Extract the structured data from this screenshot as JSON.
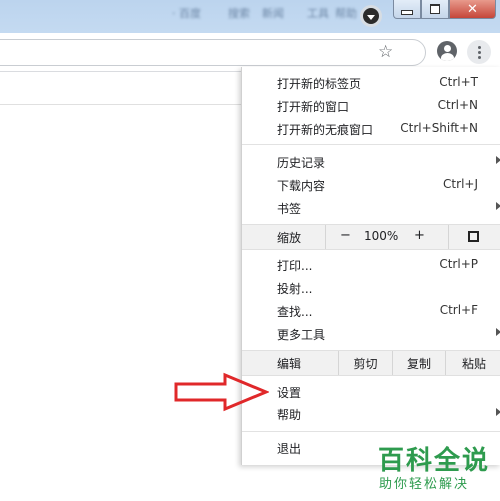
{
  "titlebar": {
    "blurred_tabs": [
      "· 百度",
      "搜索",
      "新闻",
      "工具",
      "帮助"
    ]
  },
  "window_controls": {
    "minimize_icon": "minimize-icon",
    "maximize_icon": "restore-icon",
    "close_glyph": "✕"
  },
  "toolbar": {
    "bookmark_star": "☆"
  },
  "menu": {
    "group1": [
      {
        "label": "打开新的标签页",
        "shortcut": "Ctrl+T"
      },
      {
        "label": "打开新的窗口",
        "shortcut": "Ctrl+N"
      },
      {
        "label": "打开新的无痕窗口",
        "shortcut": "Ctrl+Shift+N"
      }
    ],
    "group2": [
      {
        "label": "历史记录",
        "shortcut": ""
      },
      {
        "label": "下载内容",
        "shortcut": "Ctrl+J"
      },
      {
        "label": "书签",
        "shortcut": ""
      }
    ],
    "zoom": {
      "label": "缩放",
      "minus": "−",
      "value": "100%",
      "plus": "+"
    },
    "group3": [
      {
        "label": "打印...",
        "shortcut": "Ctrl+P"
      },
      {
        "label": "投射...",
        "shortcut": ""
      },
      {
        "label": "查找...",
        "shortcut": "Ctrl+F"
      },
      {
        "label": "更多工具",
        "shortcut": ""
      }
    ],
    "edit": {
      "label": "编辑",
      "cut": "剪切",
      "copy": "复制",
      "paste": "粘贴"
    },
    "group4": [
      {
        "label": "设置",
        "shortcut": ""
      },
      {
        "label": "帮助",
        "shortcut": ""
      }
    ],
    "exit": {
      "label": "退出"
    }
  },
  "annotation": {
    "arrow_color": "#e0282a"
  },
  "watermark": {
    "title": "百科全说",
    "subtitle": "助你轻松解决",
    "color": "#2e9b4e"
  }
}
